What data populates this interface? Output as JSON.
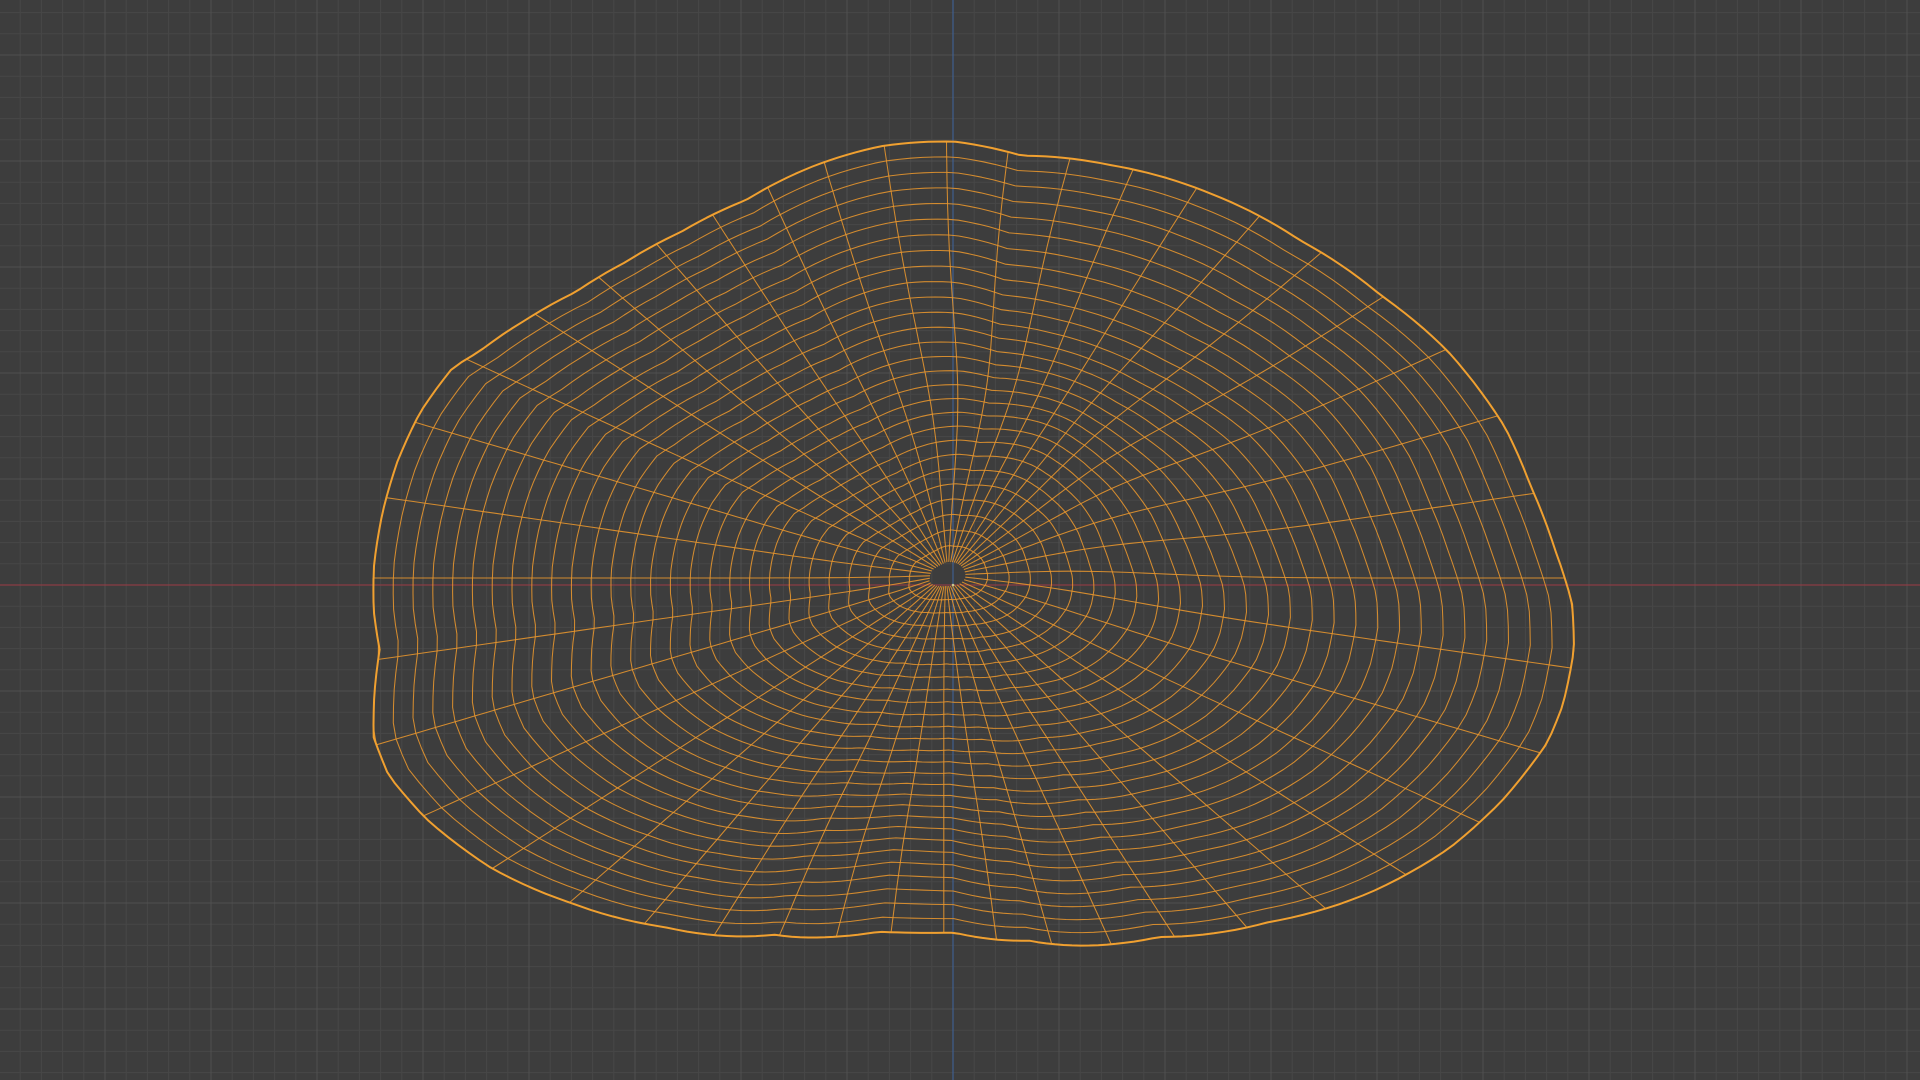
{
  "viewport": {
    "background_color": "#3d3d3d",
    "grid_minor_color": "#474747",
    "grid_major_color": "#505050",
    "x_axis_color": "#8a3d44",
    "y_axis_color": "#3f5f8f",
    "wireframe_color": "#e8962e",
    "wireframe_outline_color": "#f0a030",
    "origin_color": "#c8c890",
    "shading_mode": "wireframe",
    "selected_object": "mesh-object",
    "grid_visible": true
  }
}
